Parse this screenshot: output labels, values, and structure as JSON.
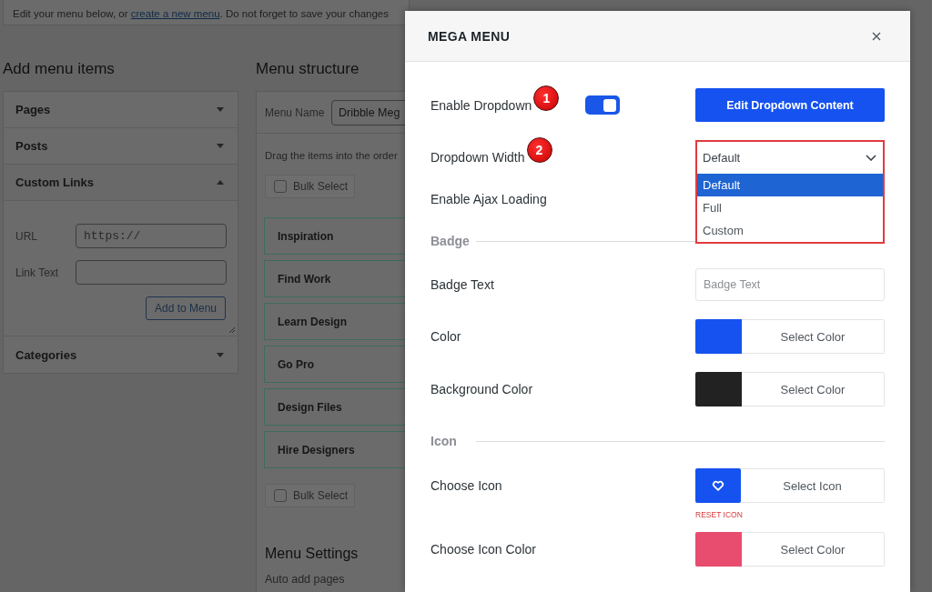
{
  "notice": {
    "text_before": "Edit your menu below, or ",
    "link": "create a new menu",
    "text_after": ". Do not forget to save your changes"
  },
  "add_menu_items": {
    "title": "Add menu items",
    "sections": [
      {
        "label": "Pages",
        "expanded": false
      },
      {
        "label": "Posts",
        "expanded": false
      },
      {
        "label": "Custom Links",
        "expanded": true,
        "fields": [
          {
            "kind": "url",
            "label": "URL",
            "placeholder": "https://"
          },
          {
            "kind": "text",
            "label": "Link Text"
          }
        ],
        "button": "Add to Menu"
      },
      {
        "label": "Categories",
        "expanded": false
      }
    ]
  },
  "menu_structure": {
    "title": "Menu structure",
    "menu_name": {
      "label": "Menu Name",
      "value": "Dribble Meg"
    },
    "instructions": "Drag the items into the order",
    "bulk_select_top": {
      "label": "Bulk Select",
      "checked": false
    },
    "items": [
      "Inspiration",
      "Find Work",
      "Learn Design",
      "Go Pro",
      "Design Files",
      "Hire Designers"
    ],
    "bulk_select_bottom": {
      "label": "Bulk Select",
      "checked": false
    },
    "settings_title": "Menu Settings",
    "auto_add_label": "Auto add pages"
  },
  "modal": {
    "title": "MEGA MENU",
    "rows": [
      {
        "kind": "toggle",
        "label": "Enable Dropdown",
        "marker": "1",
        "on": true,
        "button": "Edit Dropdown Content"
      },
      {
        "kind": "select",
        "label": "Dropdown Width",
        "marker": "2",
        "value": "Default",
        "highlighted": true,
        "expanded": true,
        "options": [
          {
            "label": "Default",
            "selected": true
          },
          {
            "label": "Full",
            "selected": false
          },
          {
            "label": "Custom",
            "selected": false
          }
        ]
      },
      {
        "kind": "label",
        "label": "Enable Ajax Loading"
      },
      {
        "kind": "section",
        "label": "Badge"
      },
      {
        "kind": "text",
        "label": "Badge Text",
        "placeholder": "Badge Text"
      },
      {
        "kind": "color",
        "label": "Color",
        "color": "#1652f0",
        "button": "Select Color"
      },
      {
        "kind": "color",
        "label": "Background Color",
        "color": "#222222",
        "button": "Select Color"
      },
      {
        "kind": "section",
        "label": "Icon"
      },
      {
        "kind": "icon",
        "label": "Choose Icon",
        "button": "Select Icon",
        "reset": "RESET ICON"
      },
      {
        "kind": "color",
        "label": "Choose Icon Color",
        "color": "#e84c6e",
        "button": "Select Color"
      }
    ]
  }
}
